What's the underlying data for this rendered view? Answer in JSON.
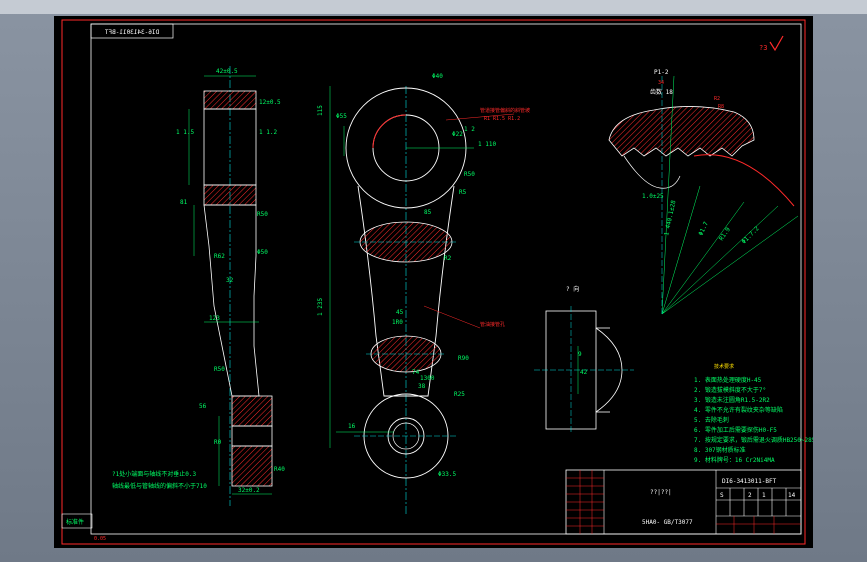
{
  "drawing": {
    "code_mirrored": "DI6-3413011-BFT",
    "scale_mark": "?3",
    "footer_label": "标准件",
    "footer_small": "0.05",
    "colors": {
      "background": "#000000",
      "frame": "#ff2a2a",
      "outline": "#ffffff",
      "dimension": "#00ff66",
      "centerline": "#00e0e0",
      "hatch": "#ff2a2a",
      "note": "#ffe000"
    }
  },
  "side_view": {
    "dims": [
      "42±0.5",
      "12±0.5",
      "1 1.5",
      "1 1.2",
      "81",
      "Φ50",
      "R62",
      "R50",
      "32",
      "123",
      "R50",
      "56",
      "R0",
      "R40",
      "32±0.2"
    ],
    "notes": [
      "?1处小端面与轴线不对垂止0.3",
      "轴线最低与管轴线的偏斜不小于710"
    ]
  },
  "front_view": {
    "dims": [
      "Φ40",
      "115",
      "Φ55",
      "Φ22",
      "1 2",
      "1 110",
      "R50",
      "R5",
      "85",
      "R2",
      "1 235",
      "1R0",
      "45",
      "74",
      "R25",
      "1300",
      "38",
      "16",
      "Φ33.5",
      "R90"
    ],
    "callouts": [
      "管道接管偏斜的斜管坡",
      "R1  R1.5  R1.2",
      "管油接管孔"
    ]
  },
  "section_view": {
    "label": "? 向",
    "dims": [
      "9",
      "42"
    ]
  },
  "gear_detail": {
    "label": "P1-2",
    "ratio": "34",
    "module_label": "齿数 18",
    "dims": [
      "R2",
      "R8",
      "1.0±25",
      "1 440.1±28",
      "Φ1.7",
      "R1.9",
      "Φ1.7.2"
    ]
  },
  "tech_requirements": {
    "title": "技术要求",
    "items": [
      "1. 表面热处理硬度H-45",
      "2. 锻造拔模斜度不大于7°",
      "3. 锻造未注圆角R1.5-2R2",
      "4. 零件不允许有裂纹夹杂等缺陷",
      "5. 去除毛刺",
      "6. 零件加工后需要探伤H0-F5",
      "7. 按规定要求，锻后需退火调质HB250~285",
      "8. 307钢材质标准",
      "9. 材料牌号：16 Cr2Ni4MA"
    ]
  },
  "title_block": {
    "code": "DI6-3413011-BFT",
    "name": "??|??|",
    "material": "5HA0- GB/T3077",
    "stage_cols": [
      "S",
      "",
      "2",
      "1",
      "",
      "14"
    ]
  }
}
